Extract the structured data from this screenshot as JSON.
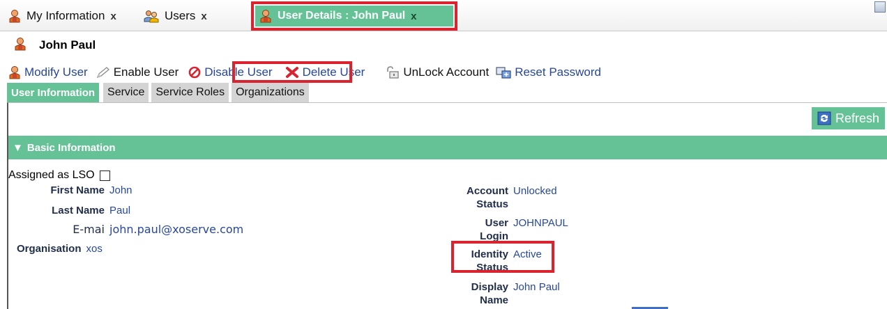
{
  "tabs": [
    {
      "label": "My Information",
      "icon": "user-icon",
      "close": "x"
    },
    {
      "label": "Users",
      "icon": "users-icon",
      "close": "x"
    },
    {
      "label": "User Details : John Paul",
      "icon": "user-icon",
      "close": "x",
      "active": true
    }
  ],
  "header": {
    "user_name": "John Paul",
    "icon": "user-icon"
  },
  "toolbar": {
    "modify": "Modify User",
    "enable": "Enable User",
    "disable": "Disable User",
    "delete": "Delete User",
    "unlock": "UnLock Account",
    "reset": "Reset Password"
  },
  "subtabs": [
    "User Information",
    "Service",
    "Service Roles",
    "Organizations"
  ],
  "refresh_label": "Refresh",
  "section": {
    "title": "Basic Information",
    "collapsed": false
  },
  "lso": {
    "label": "Assigned as LSO",
    "checked": false
  },
  "left_fields": [
    {
      "label": "First Name",
      "value": "John"
    },
    {
      "label": "Last Name",
      "value": "Paul"
    },
    {
      "label": "E-mai",
      "value": "john.paul@xoserve.com"
    },
    {
      "label": "Organisation",
      "value": "xos"
    }
  ],
  "right_fields": [
    {
      "label_line1": "Account",
      "label_line2": "Status",
      "value": "Unlocked"
    },
    {
      "label_line1": "User",
      "label_line2": "Login",
      "value": "JOHNPAUL"
    },
    {
      "label_line1": "Identity",
      "label_line2": "Status",
      "value": "Active"
    },
    {
      "label_line1": "Display",
      "label_line2": "Name",
      "value": "John Paul"
    }
  ],
  "colors": {
    "accent": "#64c296",
    "link": "#27479a",
    "highlight": "#d9232e",
    "delete": "#d9232e"
  }
}
